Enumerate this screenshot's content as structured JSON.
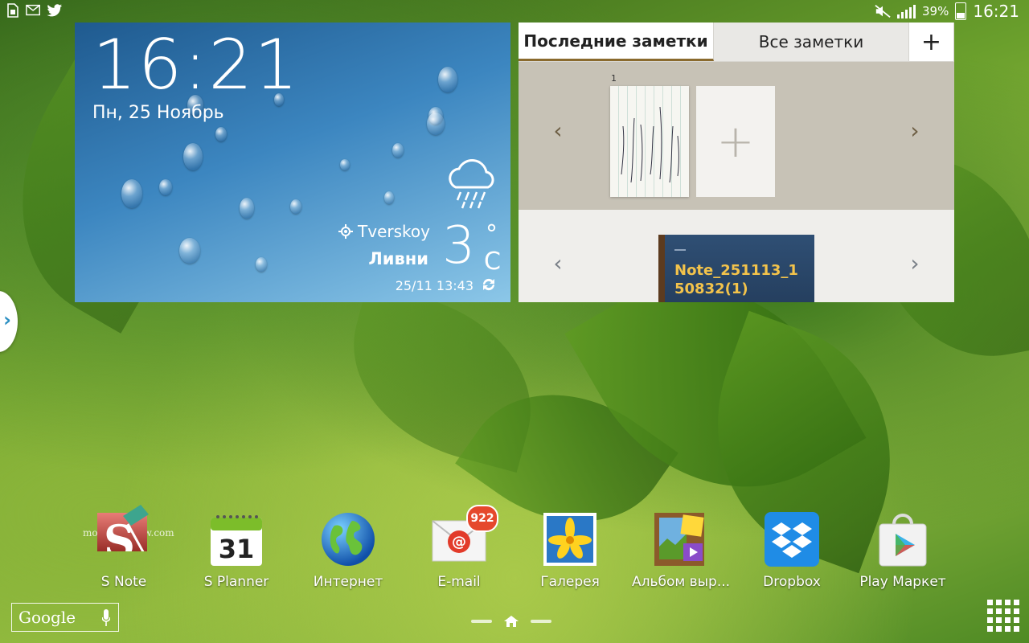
{
  "status_bar": {
    "time": "16:21",
    "battery": "39%",
    "left_icons": [
      "sim-icon",
      "mail-icon",
      "twitter-icon"
    ],
    "right_icons": [
      "mute-icon",
      "signal-icon",
      "battery-icon"
    ]
  },
  "weather_widget": {
    "time": "16:21",
    "date": "Пн, 25 Ноябрь",
    "location": "Tverskoy",
    "condition": "Ливни",
    "temperature": "3",
    "degree_symbol": "°",
    "unit": "C",
    "updated": "25/11 13:43"
  },
  "notes_widget": {
    "tabs": [
      "Последние заметки",
      "Все заметки",
      "+"
    ],
    "thumb_number": "1",
    "add_symbol": "+",
    "nav_prev": "‹",
    "nav_next": "›",
    "notebook_title": "Note_251113_1\n50832(1)"
  },
  "side_handle": "›",
  "watermark": "mobile-review.com",
  "dock": [
    {
      "label": "S Note",
      "icon": "s-note-icon"
    },
    {
      "label": "S Planner",
      "icon": "calendar-icon",
      "calendar_day": "31"
    },
    {
      "label": "Интернет",
      "icon": "globe-icon"
    },
    {
      "label": "E-mail",
      "icon": "email-icon",
      "badge": "922"
    },
    {
      "label": "Галерея",
      "icon": "gallery-icon"
    },
    {
      "label": "Альбом выр...",
      "icon": "album-icon"
    },
    {
      "label": "Dropbox",
      "icon": "dropbox-icon"
    },
    {
      "label": "Play Маркет",
      "icon": "play-store-icon"
    }
  ],
  "bottom_bar": {
    "search_label": "Google"
  },
  "colors": {
    "badge": "#e5482c",
    "accent_tab": "#8a6a2e",
    "notebook_text": "#f3c34b"
  }
}
